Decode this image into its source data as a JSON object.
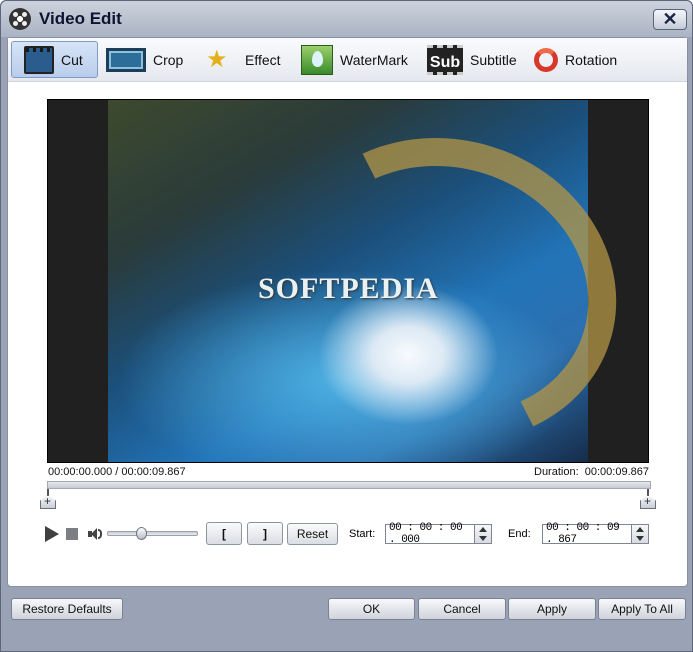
{
  "window": {
    "title": "Video Edit",
    "close_label": "✕"
  },
  "tabs": [
    {
      "label": "Cut",
      "icon": "film-cut-icon",
      "active": true
    },
    {
      "label": "Crop",
      "icon": "crop-icon"
    },
    {
      "label": "Effect",
      "icon": "star-effect-icon"
    },
    {
      "label": "WaterMark",
      "icon": "watermark-drop-icon"
    },
    {
      "label": "Subtitle",
      "icon": "subtitle-icon"
    },
    {
      "label": "Rotation",
      "icon": "rotation-icon"
    }
  ],
  "video": {
    "watermark_text": "SOFTPEDIA"
  },
  "timeline": {
    "position": "00:00:00.000 / 00:00:09.867",
    "duration_label": "Duration:",
    "duration_value": "00:00:09.867"
  },
  "controls": {
    "set_start_label": "[",
    "set_end_label": "]",
    "reset_label": "Reset",
    "start_label": "Start:",
    "start_value": "00 : 00 : 00 . 000",
    "end_label": "End:",
    "end_value": "00 : 00 : 09 . 867",
    "volume_level": 0.35
  },
  "footer": {
    "restore_label": "Restore Defaults",
    "ok_label": "OK",
    "cancel_label": "Cancel",
    "apply_label": "Apply",
    "apply_all_label": "Apply To All"
  }
}
